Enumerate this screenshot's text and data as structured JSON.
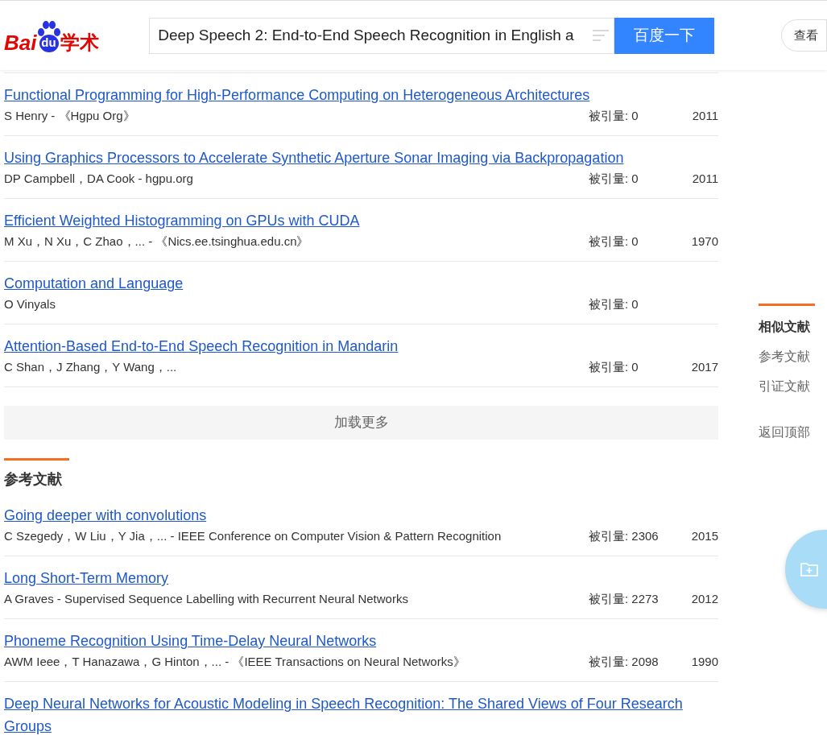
{
  "header": {
    "logo": {
      "left": "Bai",
      "paw": "du",
      "right": "学术"
    },
    "search": {
      "value": "Deep Speech 2: End-to-End Speech Recognition in English a"
    },
    "search_button": "百度一下",
    "side_button": "查看"
  },
  "similar_results": [
    {
      "title": "Functional Programming for High-Performance Computing on Heterogeneous Architectures",
      "meta": "S Henry - 《Hgpu Org》",
      "citations": "被引量: 0",
      "year": "2011"
    },
    {
      "title": "Using Graphics Processors to Accelerate Synthetic Aperture Sonar Imaging via Backpropagation",
      "meta": "DP Campbell，DA Cook - hgpu.org",
      "citations": "被引量: 0",
      "year": "2011"
    },
    {
      "title": "Efficient Weighted Histogramming on GPUs with CUDA",
      "meta": "M Xu，N Xu，C Zhao，... - 《Nics.ee.tsinghua.edu.cn》",
      "citations": "被引量: 0",
      "year": "1970"
    },
    {
      "title": "Computation and Language",
      "meta": "O Vinyals",
      "citations": "被引量: 0"
    },
    {
      "title": "Attention-Based End-to-End Speech Recognition in Mandarin",
      "meta": "C Shan，J Zhang，Y Wang，...",
      "citations": "被引量: 0",
      "year": "2017"
    }
  ],
  "load_more": "加载更多",
  "references": {
    "heading": "参考文献",
    "results": [
      {
        "title": "Going deeper with convolutions",
        "meta": "C Szegedy，W Liu，Y Jia，... - IEEE Conference on Computer Vision & Pattern Recognition",
        "citations": "被引量: 2306",
        "year": "2015"
      },
      {
        "title": "Long Short-Term Memory",
        "meta": "A Graves - Supervised Sequence Labelling with Recurrent Neural Networks",
        "citations": "被引量: 2273",
        "year": "2012"
      },
      {
        "title": "Phoneme Recognition Using Time-Delay Neural Networks",
        "meta": "AWM Ieee，T Hanazawa，G Hinton，... - 《IEEE Transactions on Neural Networks》",
        "citations": "被引量: 2098",
        "year": "1990"
      },
      {
        "title": "Deep Neural Networks for Acoustic Modeling in Speech Recognition: The Shared Views of Four Research Groups"
      }
    ]
  },
  "side_nav": {
    "items": [
      {
        "label": "相似文献",
        "selected": true
      },
      {
        "label": "参考文献",
        "selected": false
      },
      {
        "label": "引证文献",
        "selected": false
      }
    ],
    "back_to_top": "返回顶部"
  }
}
